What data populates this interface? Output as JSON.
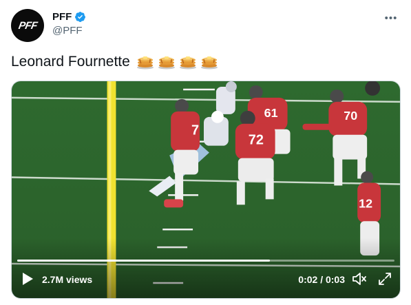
{
  "author": {
    "display_name": "PFF",
    "handle": "@PFF",
    "avatar_text": "PFF",
    "verified": true
  },
  "tweet": {
    "text": "Leonard Fournette",
    "emoji": [
      "pancakes",
      "pancakes",
      "pancakes",
      "pancakes"
    ]
  },
  "video": {
    "views": "2.7M views",
    "time": "0:02 / 0:03",
    "progress": 0.67
  },
  "colors": {
    "text": "#0f1419",
    "secondary": "#536471",
    "verified": "#1d9bf0",
    "field": "#2f6a2e",
    "jersey": "#c8363b"
  },
  "icons": {
    "more": "more-horizontal-icon",
    "play": "play-icon",
    "volume": "volume-muted-icon",
    "fullscreen": "fullscreen-icon"
  }
}
